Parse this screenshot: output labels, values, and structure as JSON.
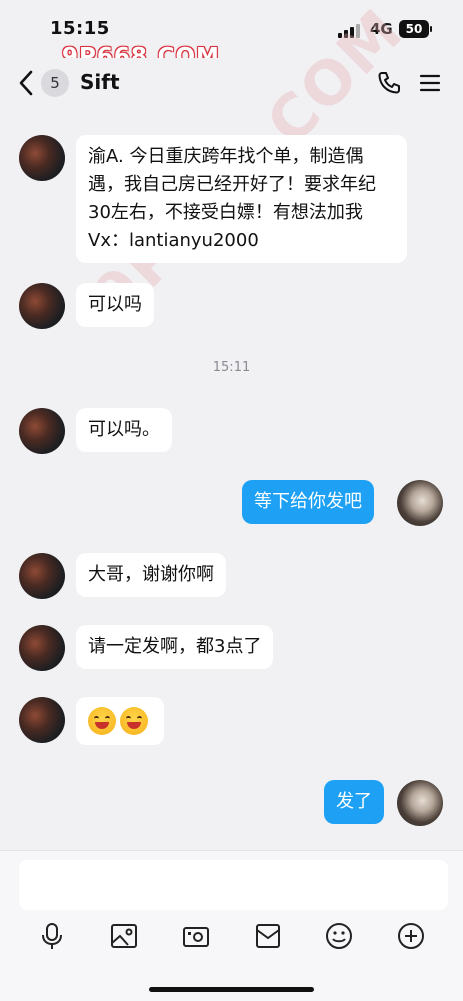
{
  "status": {
    "time": "15:15",
    "network": "4G",
    "battery": "50"
  },
  "watermark": {
    "top": "9P668.COM",
    "middle": "9P668.COM"
  },
  "header": {
    "unread_count": "5",
    "title": "Sift"
  },
  "messages": [
    {
      "side": "left",
      "text": "渝A.  今日重庆跨年找个单，制造偶遇，我自己房已经开好了！要求年纪30左右，不接受白嫖！有想法加我Vx：lantianyu2000"
    },
    {
      "side": "left",
      "text": "可以吗"
    },
    {
      "side": "left",
      "text": "可以吗。"
    },
    {
      "side": "right",
      "text": "等下给你发吧"
    },
    {
      "side": "left",
      "text": "大哥，谢谢你啊"
    },
    {
      "side": "left",
      "text": "请一定发啊，都3点了"
    },
    {
      "side": "left",
      "text": ""
    },
    {
      "side": "right",
      "text": "发了"
    }
  ],
  "timestamp": "15:11",
  "composer": {
    "placeholder": ""
  },
  "toolbar": [
    "microphone-icon",
    "image-icon",
    "camera-icon",
    "envelope-icon",
    "emoji-icon",
    "plus-icon"
  ],
  "colors": {
    "bubble_me": "#1ea1f5",
    "background": "#f1f1f4",
    "watermark": "#d9333f"
  }
}
